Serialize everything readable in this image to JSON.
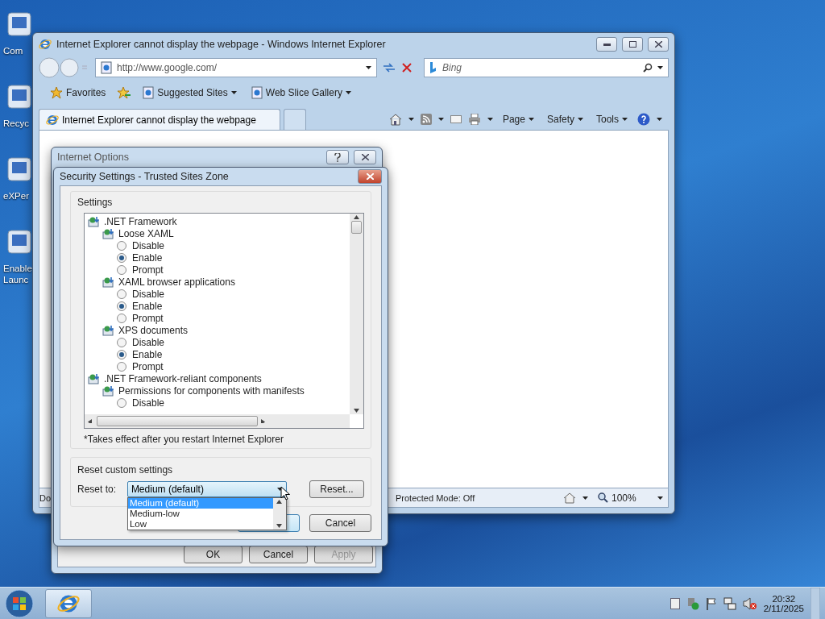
{
  "desktop_icons": [
    {
      "lines": [
        "Com"
      ]
    },
    {
      "lines": [
        "Recyc"
      ]
    },
    {
      "lines": [
        "eXPer"
      ]
    },
    {
      "lines": [
        "Enable",
        "Launc"
      ]
    }
  ],
  "browser": {
    "title": "Internet Explorer cannot display the webpage - Windows Internet Explorer",
    "address": "http://www.google.com/",
    "search_placeholder": "Bing",
    "favorites_bar": {
      "favorites": "Favorites",
      "links": [
        "Suggested Sites",
        "Web Slice Gallery"
      ]
    },
    "tabs": [
      {
        "label": "Internet Explorer cannot display the webpage",
        "selected": true
      }
    ],
    "commands": [
      "Page",
      "Safety",
      "Tools"
    ],
    "status": {
      "text": "Do",
      "protected_mode": "Protected Mode: Off",
      "zoom": "100%"
    }
  },
  "internet_options": {
    "title": "Internet Options",
    "buttons": [
      {
        "label": "OK",
        "disabled": false
      },
      {
        "label": "Cancel",
        "disabled": false
      },
      {
        "label": "Apply",
        "disabled": true
      }
    ]
  },
  "security_settings": {
    "title": "Security Settings - Trusted Sites Zone",
    "settings_label": "Settings",
    "tree": [
      {
        "label": ".NET Framework",
        "kind": "group",
        "children": [
          {
            "label": "Loose XAML",
            "kind": "group",
            "children": [
              {
                "label": "Disable",
                "kind": "option",
                "selected": false
              },
              {
                "label": "Enable",
                "kind": "option",
                "selected": true
              },
              {
                "label": "Prompt",
                "kind": "option",
                "selected": false
              }
            ]
          },
          {
            "label": "XAML browser applications",
            "kind": "group",
            "children": [
              {
                "label": "Disable",
                "kind": "option",
                "selected": false
              },
              {
                "label": "Enable",
                "kind": "option",
                "selected": true
              },
              {
                "label": "Prompt",
                "kind": "option",
                "selected": false
              }
            ]
          },
          {
            "label": "XPS documents",
            "kind": "group",
            "children": [
              {
                "label": "Disable",
                "kind": "option",
                "selected": false
              },
              {
                "label": "Enable",
                "kind": "option",
                "selected": true
              },
              {
                "label": "Prompt",
                "kind": "option",
                "selected": false
              }
            ]
          }
        ]
      },
      {
        "label": ".NET Framework-reliant components",
        "kind": "group",
        "children": [
          {
            "label": "Permissions for components with manifests",
            "kind": "group",
            "children": [
              {
                "label": "Disable",
                "kind": "option",
                "selected": false
              }
            ]
          }
        ]
      }
    ],
    "note": "*Takes effect after you restart Internet Explorer",
    "reset_group": "Reset custom settings",
    "reset_label": "Reset to:",
    "reset_value": "Medium (default)",
    "reset_options": [
      {
        "label": "Medium (default)",
        "selected": true
      },
      {
        "label": "Medium-low",
        "selected": false
      },
      {
        "label": "Low",
        "selected": false
      }
    ],
    "reset_button": "Reset...",
    "buttons": [
      {
        "label": "Cancel"
      }
    ]
  },
  "taskbar": {
    "time": "20:32",
    "date": "2/11/2025"
  }
}
